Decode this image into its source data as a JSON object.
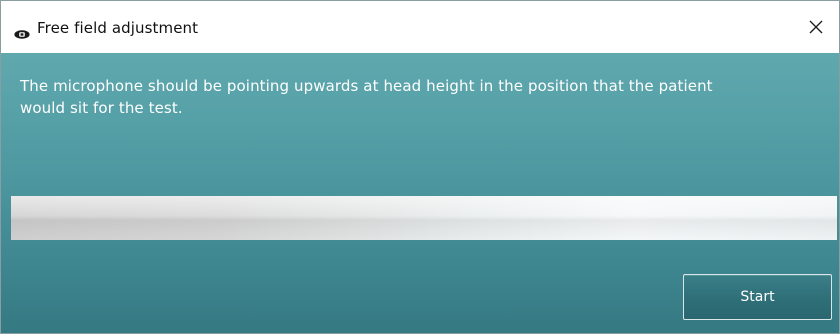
{
  "window": {
    "title": "Free field adjustment",
    "app_icon": "speaker-icon",
    "close_icon": "close-icon"
  },
  "content": {
    "instruction": "The microphone should be pointing upwards at head height in the position that the patient would sit for the test.",
    "progress": {
      "value_fraction": 1.0
    },
    "start_label": "Start"
  },
  "colors": {
    "panel_top": "#5fa8ae",
    "panel_bottom": "#357982",
    "button": "#2f6f78",
    "text_light": "#ffffff",
    "text_dark": "#111111"
  }
}
